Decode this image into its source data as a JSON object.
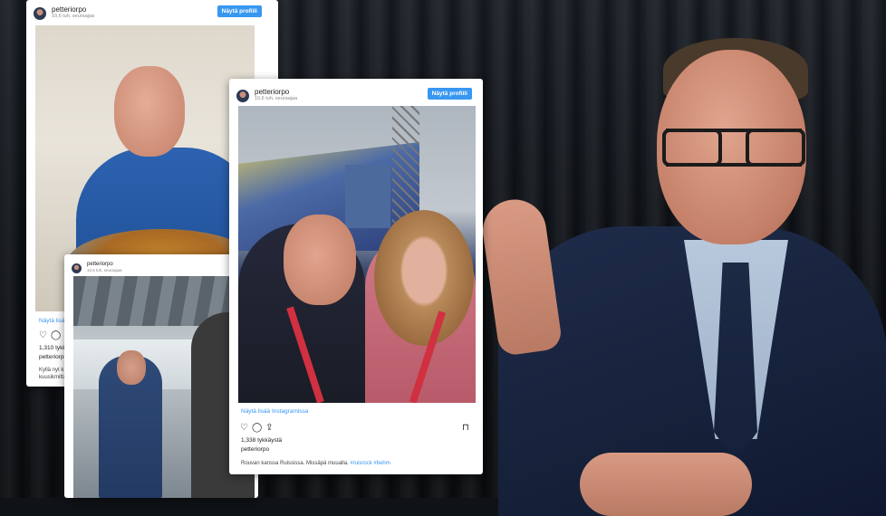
{
  "card_back": {
    "username": "petteriorpo",
    "followers": "10,6 tuh. seuraajaa",
    "profile_button": "Näytä profiili",
    "more_link": "Näytä lisää",
    "likes": "1,310 tykkä",
    "caption_user": "petteriorpo",
    "caption_line1": "Kyllä nyt k",
    "caption_line2": "kuusikmitta"
  },
  "card_small": {
    "username": "petteriorpo",
    "followers": "10,6 tuh. seuraajaa"
  },
  "card_front": {
    "username": "petteriorpo",
    "followers": "10,6 tuh. seuraajaa",
    "profile_button": "Näytä profiili",
    "more_link": "Näytä lisää Instagramissa",
    "likes": "1,338 tykkäystä",
    "caption_user": "petteriorpo",
    "caption_text": "Rouvan kanssa Ruississa. Missäpä muualla. ",
    "caption_tags": "#ruisrock #behm"
  },
  "icons": [
    "heart-icon",
    "comment-icon",
    "share-icon",
    "bookmark-icon"
  ]
}
